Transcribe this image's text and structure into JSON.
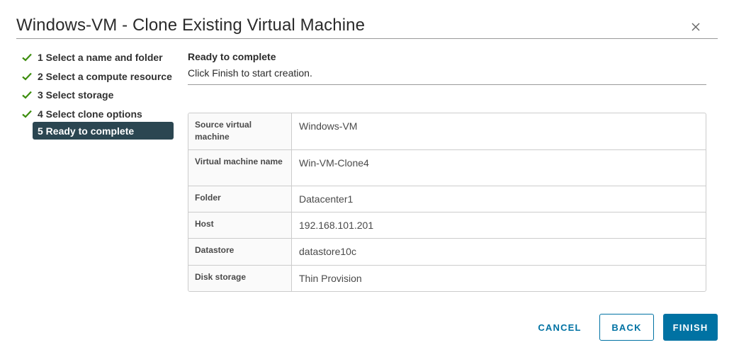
{
  "dialog": {
    "title": "Windows-VM - Clone Existing Virtual Machine",
    "close_icon": "close-icon"
  },
  "steps": [
    {
      "label": "1 Select a name and folder",
      "done": true
    },
    {
      "label": "2 Select a compute resource",
      "done": true
    },
    {
      "label": "3 Select storage",
      "done": true
    },
    {
      "label": "4 Select clone options",
      "done": true
    },
    {
      "label": "5 Ready to complete",
      "done": false,
      "active": true
    }
  ],
  "content": {
    "heading": "Ready to complete",
    "subtext": "Click Finish to start creation."
  },
  "summary": [
    {
      "key": "Source virtual machine",
      "value": "Windows-VM"
    },
    {
      "key": "Virtual machine name",
      "value": "Win-VM-Clone4"
    },
    {
      "key": "Folder",
      "value": "Datacenter1"
    },
    {
      "key": "Host",
      "value": "192.168.101.201"
    },
    {
      "key": "Datastore",
      "value": "datastore10c"
    },
    {
      "key": "Disk storage",
      "value": "Thin Provision"
    }
  ],
  "buttons": {
    "cancel": "CANCEL",
    "back": "BACK",
    "finish": "FINISH"
  },
  "colors": {
    "accent": "#0072a3",
    "check": "#3c8d0d",
    "active_step_bg": "#2b4651"
  }
}
